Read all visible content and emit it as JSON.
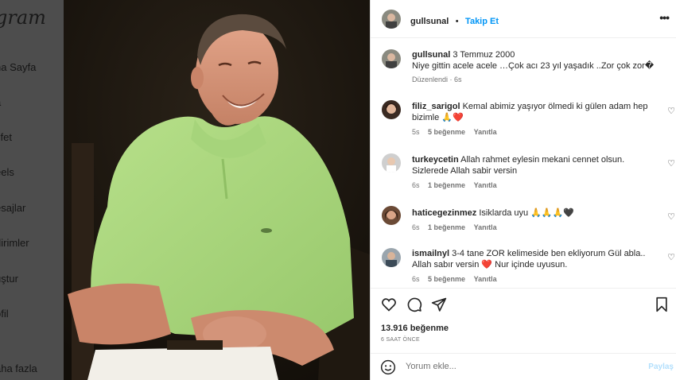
{
  "sidebar": {
    "logo": "gram",
    "items": [
      {
        "label": "na Sayfa"
      },
      {
        "label": "a"
      },
      {
        "label": "şfet"
      },
      {
        "label": "eels"
      },
      {
        "label": "esajlar"
      },
      {
        "label": "dirimler"
      },
      {
        "label": "uştur"
      },
      {
        "label": "ofil"
      },
      {
        "label": "aha fazla"
      }
    ]
  },
  "post": {
    "author": "gullsunal",
    "separator": "•",
    "follow_label": "Takip Et",
    "caption": {
      "username": "gullsunal",
      "text_line1": "3 Temmuz 2000",
      "text_line2": "Niye gittin acele acele …Çok acı 23 yıl yaşadık ..Zor çok zor�",
      "meta": "Düzenlendi · 6s"
    },
    "comments": [
      {
        "username": "filiz_sarigol",
        "text1": "Kemal abimiz yaşıyor ölmedi ki gülen adam hep",
        "text2": "bizimle 🙏❤️",
        "age": "5s",
        "likes": "5 beğenme",
        "reply": "Yanıtla"
      },
      {
        "username": "turkeycetin",
        "text1": "Allah rahmet eylesin mekani cennet olsun.",
        "text2": "Sizlerede Allah sabir versin",
        "age": "6s",
        "likes": "1 beğenme",
        "reply": "Yanıtla"
      },
      {
        "username": "haticegezinmez",
        "text1": "Isiklarda uyu 🙏🙏🙏🖤",
        "text2": "",
        "age": "6s",
        "likes": "1 beğenme",
        "reply": "Yanıtla"
      },
      {
        "username": "ismailnyl",
        "text1": "3-4 tane ZOR kelimeside ben ekliyorum Gül abla..",
        "text2": "Allah sabır versin ❤️ Nur içinde uyusun.",
        "age": "6s",
        "likes": "5 beğenme",
        "reply": "Yanıtla"
      }
    ],
    "likes_count": "13.916 beğenme",
    "time_ago": "6 SAAT ÖNCE",
    "comment_placeholder": "Yorum ekle...",
    "share_label": "Paylaş"
  },
  "colors": {
    "accent": "#0095f6",
    "text": "#262626",
    "muted": "#737373",
    "shirt": "#a9d77c"
  }
}
